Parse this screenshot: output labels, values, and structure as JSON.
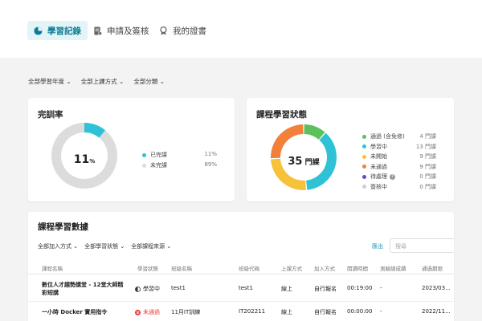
{
  "tabs": [
    {
      "label": "學習記錄",
      "icon": "pie-chart-icon",
      "active": true
    },
    {
      "label": "申請及簽核",
      "icon": "document-icon",
      "active": false
    },
    {
      "label": "我的證書",
      "icon": "award-icon",
      "active": false
    }
  ],
  "filters": [
    "全部學習年度 ⌄",
    "全部上課方式 ⌄",
    "全部分類 ⌄"
  ],
  "completion": {
    "title": "完訓率",
    "center_value": "11",
    "center_unit": "%",
    "legend": [
      {
        "label": "已完課",
        "value": "11%",
        "color": "#2fc2d6"
      },
      {
        "label": "未完課",
        "value": "89%",
        "color": "#dcdcdc"
      }
    ]
  },
  "course_status": {
    "title": "課程學習狀態",
    "center_value": "35",
    "center_unit": "門課",
    "legend": [
      {
        "label": "通過 (含免修)",
        "value": "4 門課",
        "color": "#5cc05c"
      },
      {
        "label": "學習中",
        "value": "13 門課",
        "color": "#2fc2d6"
      },
      {
        "label": "未開始",
        "value": "9 門課",
        "color": "#f5c23a"
      },
      {
        "label": "未通過",
        "value": "9 門課",
        "color": "#f2803a"
      },
      {
        "label": "待處理",
        "value": "0 門課",
        "color": "#5a4fcf"
      },
      {
        "label": "簽核中",
        "value": "0 門課",
        "color": "#cfcfcf"
      }
    ]
  },
  "chart_data": [
    {
      "type": "pie",
      "title": "完訓率",
      "categories": [
        "已完課",
        "未完課"
      ],
      "values": [
        11,
        89
      ]
    },
    {
      "type": "pie",
      "title": "課程學習狀態",
      "categories": [
        "通過 (含免修)",
        "學習中",
        "未開始",
        "未通過",
        "待處理",
        "簽核中"
      ],
      "values": [
        4,
        13,
        9,
        9,
        0,
        0
      ]
    }
  ],
  "table_card": {
    "title": "課程學習數據",
    "subfilters": [
      "全部加入方式 ⌄",
      "全部學習狀態 ⌄",
      "全部課程來源 ⌄"
    ],
    "export_label": "匯出",
    "search_placeholder": "搜尋",
    "headers": [
      "課程名稱",
      "學習狀態",
      "班級名稱",
      "班級代碼",
      "上課方式",
      "加入方式",
      "閱讀時間",
      "測驗總成績",
      "通過期限"
    ],
    "rows": [
      {
        "name": "數位人才趨勢講堂 - 12堂大師精彩短講",
        "status": "學習中",
        "status_icon": "half-circle-icon",
        "status_color": "#333333",
        "class_name": "test1",
        "class_code": "test1",
        "mode": "線上",
        "join": "自行報名",
        "read_time": "00:19:00",
        "score": "-",
        "deadline": "2023/03..."
      },
      {
        "name": "一小時 Docker 實用指令",
        "status": "未通過",
        "status_icon": "x-circle-icon",
        "status_color": "#e53935",
        "class_name": "11月IT訓練",
        "class_code": "IT202211",
        "mode": "線上",
        "join": "自行報名",
        "read_time": "00:00:00",
        "score": "-",
        "deadline": "2022/11..."
      }
    ]
  }
}
